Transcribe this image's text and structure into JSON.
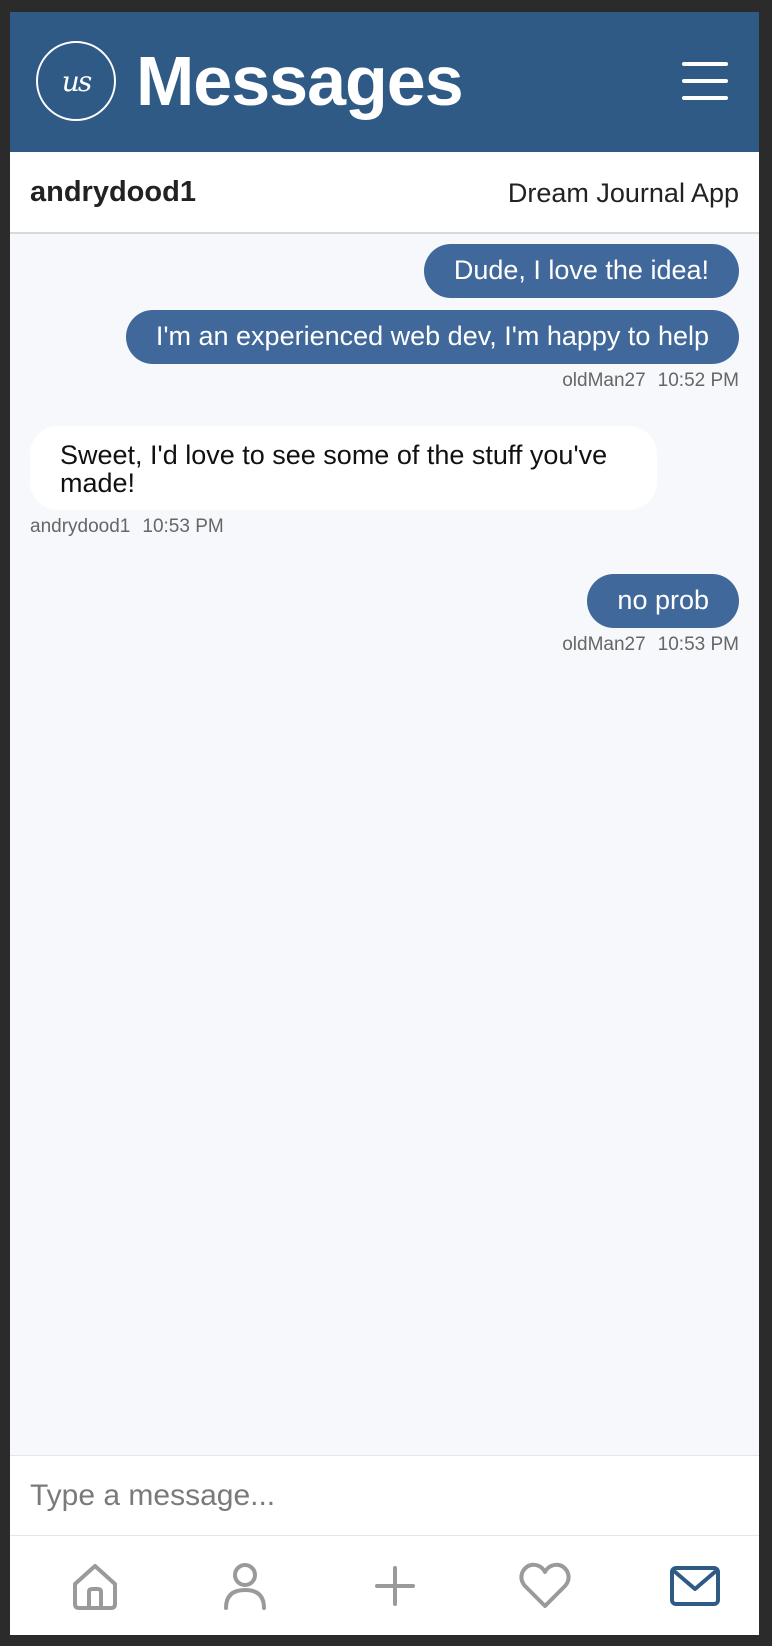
{
  "header": {
    "logo_text": "us",
    "title": "Messages",
    "menu_icon": "hamburger-menu-icon"
  },
  "conversation": {
    "username": "andrydood1",
    "project": "Dream Journal App"
  },
  "messages": [
    {
      "sender": "oldMan27",
      "direction": "outgoing",
      "text": "Dude, I love the idea!"
    },
    {
      "sender": "oldMan27",
      "direction": "outgoing",
      "text": "I'm an experienced web dev, I'm happy to help",
      "time": "10:52 PM"
    },
    {
      "sender": "andrydood1",
      "direction": "incoming",
      "text": "Sweet, I'd love to see some of the stuff you've made!",
      "time": "10:53 PM"
    },
    {
      "sender": "oldMan27",
      "direction": "outgoing",
      "text": "no prob",
      "time": "10:53 PM"
    }
  ],
  "input": {
    "placeholder": "Type a message...",
    "value": ""
  },
  "nav": {
    "items": [
      {
        "icon": "home-icon",
        "active": false
      },
      {
        "icon": "profile-icon",
        "active": false
      },
      {
        "icon": "plus-icon",
        "active": false
      },
      {
        "icon": "heart-icon",
        "active": false
      },
      {
        "icon": "mail-icon",
        "active": true
      }
    ]
  },
  "colors": {
    "header_bg": "#2f5a85",
    "outgoing_bubble": "#40689a",
    "incoming_bubble": "#ffffff",
    "chat_bg": "#f6f8fc",
    "nav_inactive": "#9a9a9a",
    "nav_active": "#2f5a85"
  }
}
